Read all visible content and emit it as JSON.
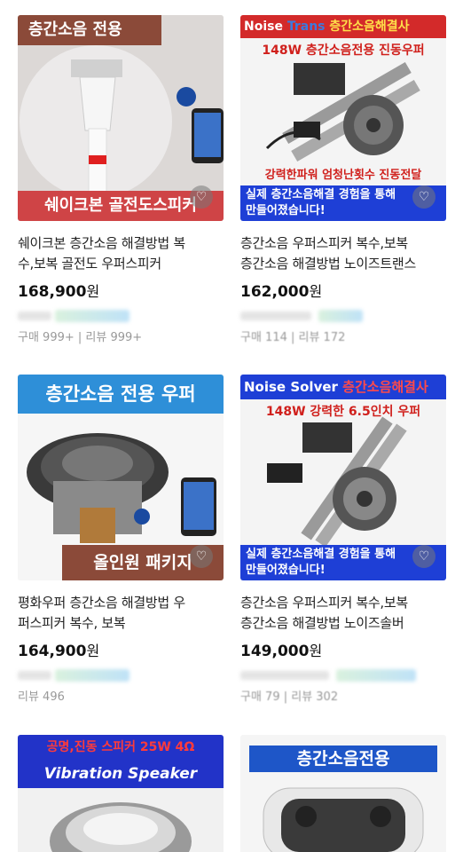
{
  "products": [
    {
      "banner_top": "층간소음 전용",
      "banner_bottom": "쉐이크본 골전도스피커",
      "name_line1": "쉐이크본 층간소음 해결방법 복",
      "name_line2": "수,보복 골전도 우퍼스피커",
      "price": "168,900",
      "currency": "원",
      "stats": "구매 999+ | 리뷰 999+"
    },
    {
      "banner_top_a": "Noise",
      "banner_top_b": "Trans",
      "banner_top_c": "층간소음해결사",
      "banner_sub": "148W 층간소음전용 진동우퍼",
      "banner_mid": "강력한파워 엄청난횟수 진동전달",
      "banner_bottom_1": "실제 층간소음해결 경험을 통해",
      "banner_bottom_2": "만들어졌습니다!",
      "name_line1": "층간소음 우퍼스피커 복수,보복",
      "name_line2": "층간소음 해결방법 노이즈트랜스",
      "price": "162,000",
      "currency": "원",
      "stats": "구매 114 | 리뷰 172"
    },
    {
      "banner_top": "층간소음 전용 우퍼",
      "banner_bottom": "올인원 패키지",
      "name_line1": "평화우퍼 층간소음 해결방법 우",
      "name_line2": "퍼스피커 복수, 보복",
      "price": "164,900",
      "currency": "원",
      "stats": "리뷰 496"
    },
    {
      "banner_top_a": "Noise Solver",
      "banner_top_c": "층간소음해결사",
      "banner_sub": "148W 강력한 6.5인치 우퍼",
      "banner_bottom_1": "실제 층간소음해결 경험을 통해",
      "banner_bottom_2": "만들어졌습니다!",
      "name_line1": "층간소음 우퍼스피커 복수,보복",
      "name_line2": "층간소음 해결방법 노이즈솔버",
      "price": "149,000",
      "currency": "원",
      "stats": "구매 79 | 리뷰 302"
    },
    {
      "banner_top": "공명,진동 스피커 25W 4Ω",
      "banner_sub": "Vibration Speaker"
    },
    {
      "banner_top": "층간소음전용"
    }
  ]
}
